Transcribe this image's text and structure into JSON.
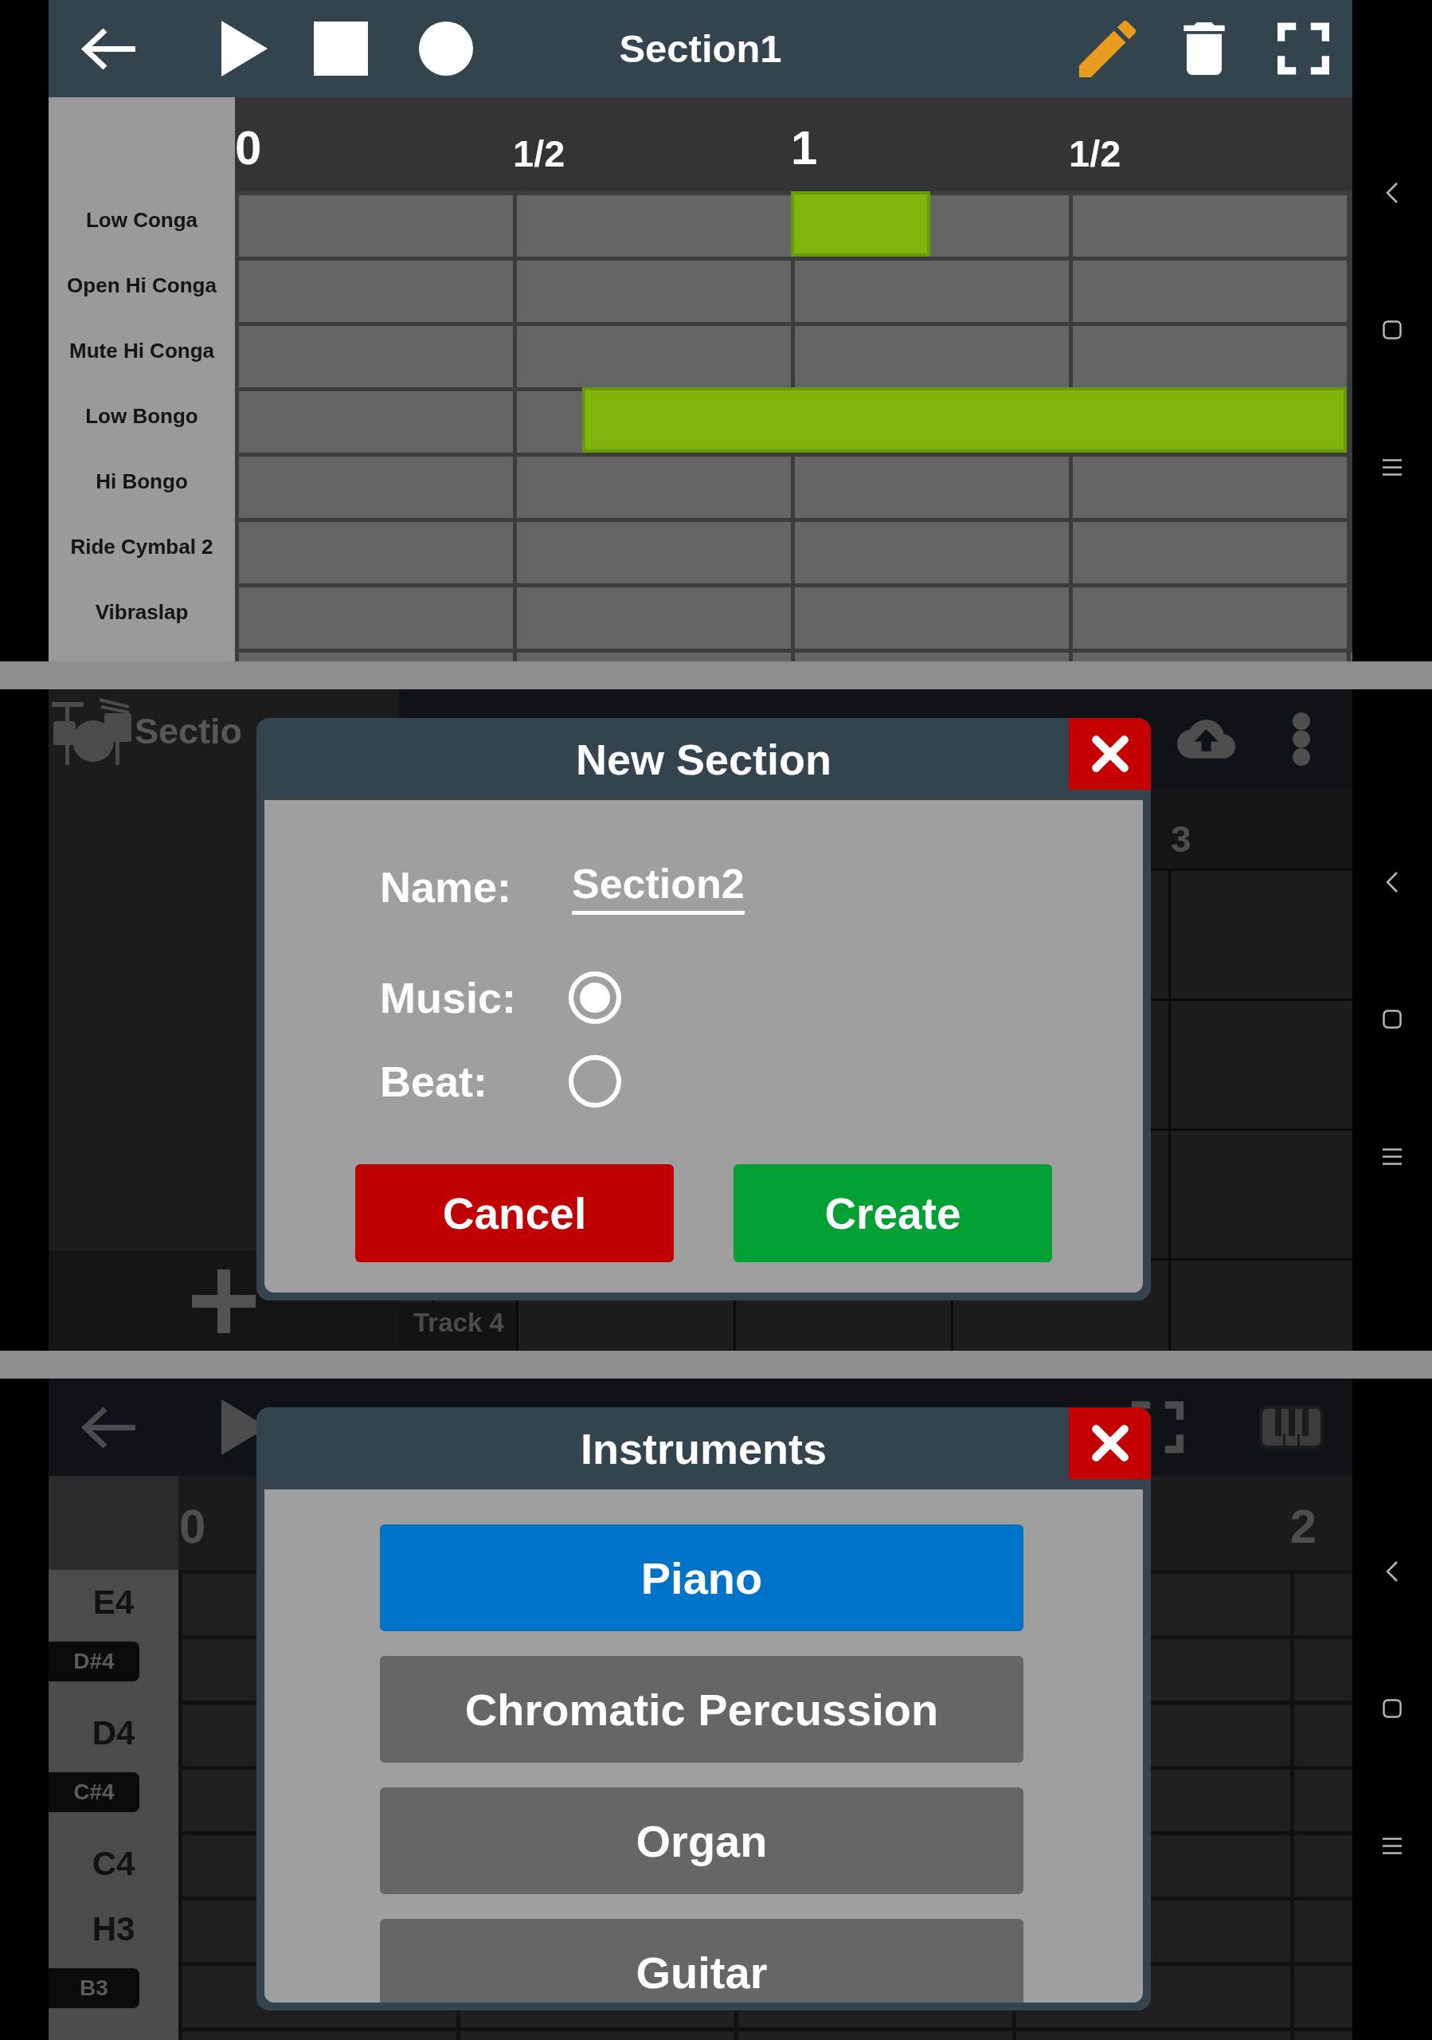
{
  "drum_editor": {
    "toolbar": {
      "title": "Section1"
    },
    "ruler": [
      {
        "label": "0",
        "kind": "beat"
      },
      {
        "label": "1/2",
        "kind": "half"
      },
      {
        "label": "1",
        "kind": "beat"
      },
      {
        "label": "1/2",
        "kind": "half"
      }
    ],
    "rows": [
      {
        "label": "Low Conga",
        "steps": [
          false,
          false,
          false,
          false,
          false,
          false,
          false,
          false,
          true,
          true,
          false,
          false,
          false,
          false,
          false,
          false
        ]
      },
      {
        "label": "Open Hi Conga",
        "steps": [
          false,
          false,
          false,
          false,
          false,
          false,
          false,
          false,
          false,
          false,
          false,
          false,
          false,
          false,
          false,
          false
        ]
      },
      {
        "label": "Mute Hi Conga",
        "steps": [
          false,
          false,
          false,
          false,
          false,
          false,
          false,
          false,
          false,
          false,
          false,
          false,
          false,
          false,
          false,
          false
        ]
      },
      {
        "label": "Low Bongo",
        "steps": [
          false,
          false,
          false,
          false,
          false,
          true,
          true,
          true,
          true,
          true,
          true,
          true,
          true,
          true,
          true,
          true
        ]
      },
      {
        "label": "Hi Bongo",
        "steps": [
          false,
          false,
          false,
          false,
          false,
          false,
          false,
          false,
          false,
          false,
          false,
          false,
          false,
          false,
          false,
          false
        ]
      },
      {
        "label": "Ride Cymbal 2",
        "steps": [
          false,
          false,
          false,
          false,
          false,
          false,
          false,
          false,
          false,
          false,
          false,
          false,
          false,
          false,
          false,
          false
        ]
      },
      {
        "label": "Vibraslap",
        "steps": [
          false,
          false,
          false,
          false,
          false,
          false,
          false,
          false,
          false,
          false,
          false,
          false,
          false,
          false,
          false,
          false
        ]
      }
    ]
  },
  "new_section_screen": {
    "section_title": "Sectio",
    "ruler_label": "3",
    "track_label": "Track 4",
    "dialog": {
      "title": "New Section",
      "name_label": "Name:",
      "name_value": "Section2",
      "options": [
        {
          "label": "Music:",
          "selected": true
        },
        {
          "label": "Beat:",
          "selected": false
        }
      ],
      "buttons": [
        {
          "label": "Cancel",
          "kind": "cancel"
        },
        {
          "label": "Create",
          "kind": "confirm"
        }
      ]
    }
  },
  "instruments_screen": {
    "ruler": [
      {
        "label": "0"
      },
      {
        "label": "2"
      }
    ],
    "keys": [
      {
        "label": "E4",
        "kind": "white"
      },
      {
        "label": "D#4",
        "kind": "black"
      },
      {
        "label": "D4",
        "kind": "white"
      },
      {
        "label": "C#4",
        "kind": "black"
      },
      {
        "label": "C4",
        "kind": "white"
      },
      {
        "label": "H3",
        "kind": "white"
      },
      {
        "label": "B3",
        "kind": "black"
      }
    ],
    "dialog": {
      "title": "Instruments",
      "items": [
        {
          "label": "Piano",
          "selected": true
        },
        {
          "label": "Chromatic Percussion",
          "selected": false
        },
        {
          "label": "Organ",
          "selected": false
        },
        {
          "label": "Guitar",
          "selected": false
        }
      ]
    }
  }
}
